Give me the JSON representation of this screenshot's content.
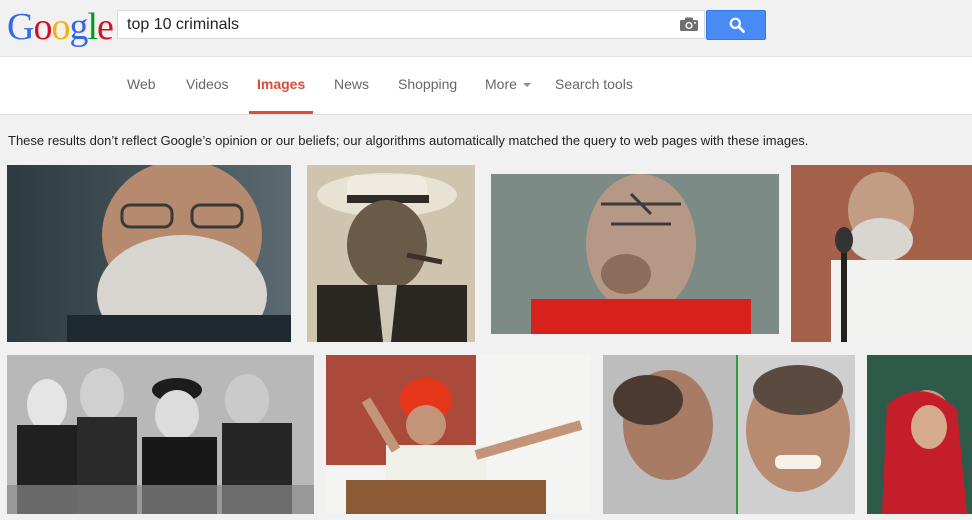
{
  "logo": {
    "letters": [
      "G",
      "o",
      "o",
      "g",
      "l",
      "e"
    ],
    "colors": [
      "#3369e8",
      "#d50f25",
      "#eeb211",
      "#3369e8",
      "#009925",
      "#d50f25"
    ]
  },
  "search": {
    "query": "top 10 criminals",
    "camera_icon": "camera-icon",
    "button_icon": "magnifier-icon"
  },
  "nav": {
    "tabs": [
      {
        "label": "Web",
        "active": false
      },
      {
        "label": "Videos",
        "active": false
      },
      {
        "label": "Images",
        "active": true
      },
      {
        "label": "News",
        "active": false
      },
      {
        "label": "Shopping",
        "active": false
      },
      {
        "label": "More",
        "active": false
      },
      {
        "label": "Search tools",
        "active": false
      }
    ],
    "accent_color": "#dd4b39"
  },
  "notice": "These results don’t reflect Google’s opinion or our beliefs; our algorithms automatically matched the query to web pages with these images.",
  "results": [
    {
      "name": "image-result-1",
      "depicts": "man with grey beard and glasses, close-up portrait"
    },
    {
      "name": "image-result-2",
      "depicts": "sepia photo of man in fedora hat with cigar"
    },
    {
      "name": "image-result-3",
      "depicts": "man with tattooed face in red shirt"
    },
    {
      "name": "image-result-4",
      "depicts": "man with grey beard speaking at microphone"
    },
    {
      "name": "image-result-5",
      "depicts": "black and white photo of crowd of men in hats"
    },
    {
      "name": "image-result-6",
      "depicts": "man in orange turban pointing at podium"
    },
    {
      "name": "image-result-7",
      "depicts": "side and front mugshot of smiling man"
    },
    {
      "name": "image-result-8",
      "depicts": "woman in red sari"
    }
  ]
}
